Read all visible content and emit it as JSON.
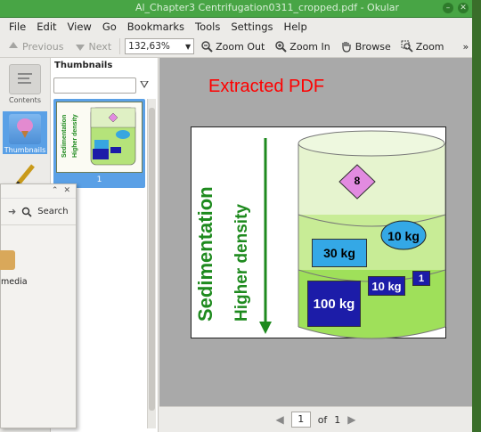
{
  "window": {
    "title": "Al_Chapter3 Centrifugation0311_cropped.pdf - Okular",
    "controls": [
      "–",
      "✕"
    ]
  },
  "menu": [
    "File",
    "Edit",
    "View",
    "Go",
    "Bookmarks",
    "Tools",
    "Settings",
    "Help"
  ],
  "toolbar": {
    "previous": "Previous",
    "next": "Next",
    "zoom_value": "132,63%",
    "zoom_out": "Zoom Out",
    "zoom_in": "Zoom In",
    "browse": "Browse",
    "zoom": "Zoom",
    "overflow": "»"
  },
  "sidebar": {
    "contents": "Contents",
    "thumbnails": "Thumbnails"
  },
  "thumbnails": {
    "header": "Thumbnails",
    "filter_placeholder": "",
    "page_number": "1"
  },
  "document": {
    "heading": "Extracted PDF",
    "label_sedimentation": "Sedimentation",
    "label_density": "Higher density",
    "marker": "8",
    "mass_top": "10 kg",
    "mass_30": "30 kg",
    "mass_10": "10 kg",
    "mass_1": "1",
    "mass_100": "100 kg"
  },
  "navigation": {
    "page": "1",
    "of_label": "of",
    "total": "1"
  },
  "file_window": {
    "controls": [
      "⌃",
      "✕"
    ],
    "search": "Search",
    "folder_label": "media"
  }
}
